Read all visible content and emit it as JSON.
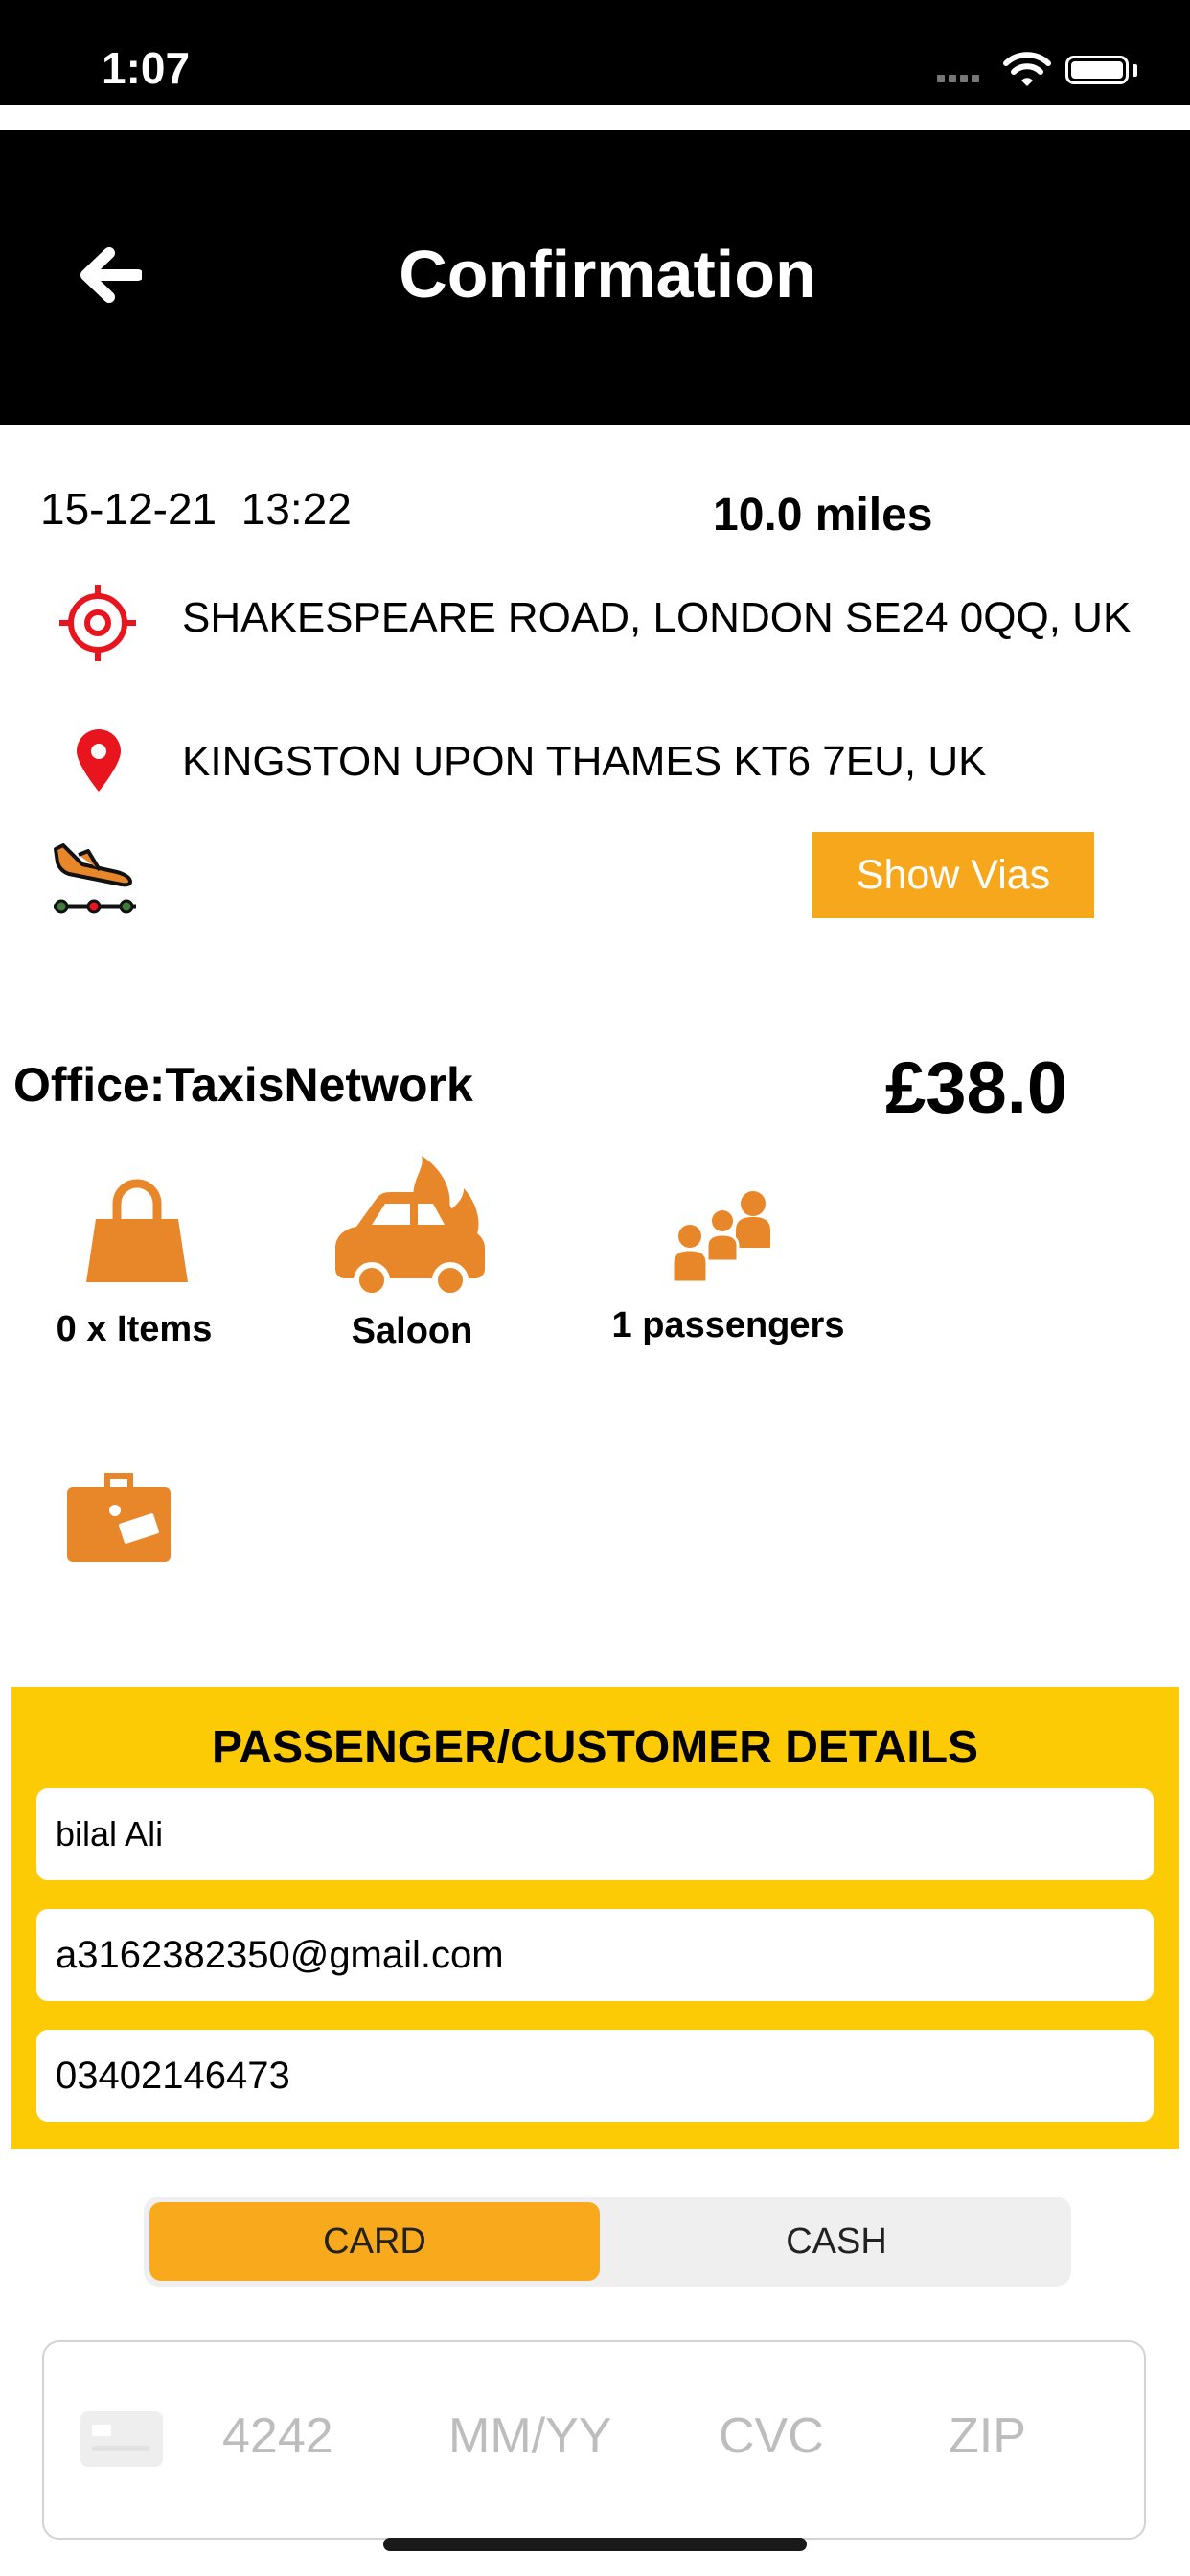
{
  "status_bar": {
    "time": "1:07"
  },
  "header": {
    "title": "Confirmation"
  },
  "trip": {
    "date": "15-12-21",
    "time": "13:22",
    "distance": "10.0 miles",
    "pickup": "SHAKESPEARE ROAD, LONDON SE24 0QQ, UK",
    "dropoff": "KINGSTON UPON THAMES KT6 7EU, UK",
    "show_vias_label": "Show Vias"
  },
  "booking": {
    "office": "Office:TaxisNetwork",
    "price": "£38.0",
    "items_label": "0 x Items",
    "vehicle_label": "Saloon",
    "passengers_label": "1 passengers"
  },
  "customer": {
    "title": "PASSENGER/CUSTOMER DETAILS",
    "name": "bilal Ali",
    "email": "a3162382350@gmail.com",
    "phone": "03402146473"
  },
  "payment": {
    "card_label": "CARD",
    "cash_label": "CASH",
    "selected": "CARD",
    "card_number_placeholder": "4242",
    "expiry_placeholder": "MM/YY",
    "cvc_placeholder": "CVC",
    "zip_placeholder": "ZIP"
  },
  "colors": {
    "accent_orange": "#f7a71c",
    "panel_yellow": "#fdca06",
    "icon_orange": "#e8862a",
    "pin_red": "#e8141e"
  },
  "icons": [
    "back-arrow-icon",
    "crosshair-icon",
    "location-pin-icon",
    "flight-landing-icon",
    "shopping-bag-icon",
    "car-icon",
    "passengers-icon",
    "luggage-icon",
    "credit-card-icon",
    "wifi-icon",
    "battery-icon"
  ]
}
